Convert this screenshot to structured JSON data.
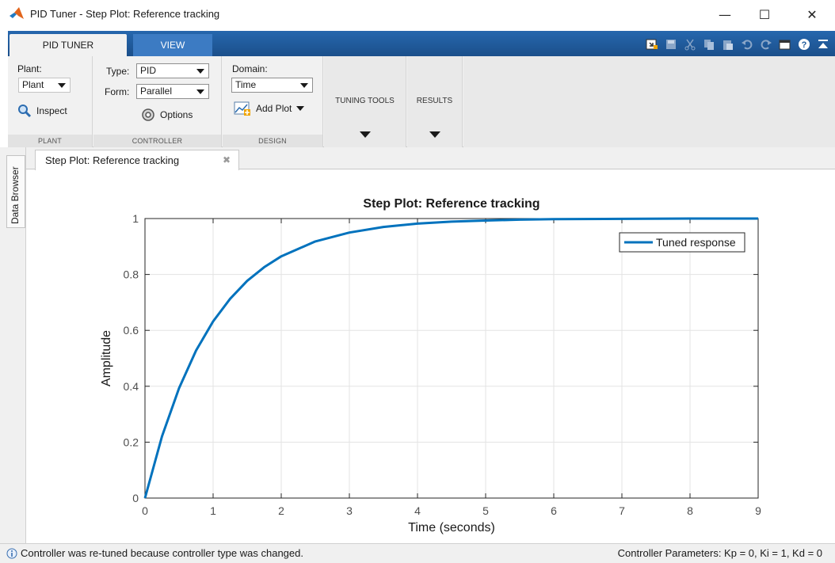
{
  "window": {
    "title": "PID Tuner - Step Plot: Reference tracking",
    "minimize_glyph": "—",
    "maximize_glyph": "☐",
    "close_glyph": "✕"
  },
  "tabs": {
    "pid_tuner": "PID TUNER",
    "view": "VIEW"
  },
  "quick_access": [
    "import-icon",
    "save-icon",
    "cut-icon",
    "copy-icon",
    "paste-icon",
    "undo-icon",
    "redo-icon",
    "window-icon",
    "help-icon",
    "collapse-icon"
  ],
  "ribbon": {
    "plant": {
      "label": "Plant:",
      "value": "Plant",
      "inspect": "Inspect",
      "group": "PLANT"
    },
    "controller": {
      "type_label": "Type:",
      "type_value": "PID",
      "form_label": "Form:",
      "form_value": "Parallel",
      "options": "Options",
      "group": "CONTROLLER"
    },
    "design": {
      "domain_label": "Domain:",
      "domain_value": "Time",
      "add_plot": "Add Plot",
      "group": "DESIGN"
    },
    "tuning_tools": "TUNING TOOLS",
    "results": "RESULTS"
  },
  "document": {
    "tab_label": "Step Plot: Reference tracking",
    "side_tab": "Data Browser"
  },
  "status": {
    "message": "Controller was re-tuned because controller type was changed.",
    "parameters": "Controller Parameters: Kp =  0, Ki =  1, Kd =  0"
  },
  "colors": {
    "ribbon_blue": "#1f5b9c",
    "series": "#0072bd"
  },
  "chart_data": {
    "type": "line",
    "title": "Step Plot: Reference tracking",
    "xlabel": "Time (seconds)",
    "ylabel": "Amplitude",
    "xlim": [
      0,
      9
    ],
    "ylim": [
      0,
      1
    ],
    "xticks": [
      "0",
      "1",
      "2",
      "3",
      "4",
      "5",
      "6",
      "7",
      "8",
      "9"
    ],
    "yticks": [
      "0",
      "0.2",
      "0.4",
      "0.6",
      "0.8",
      "1"
    ],
    "grid": true,
    "legend_position": "top-right",
    "series": [
      {
        "name": "Tuned response",
        "color": "#0072bd",
        "x": [
          0,
          0.25,
          0.5,
          0.75,
          1,
          1.25,
          1.5,
          1.75,
          2,
          2.5,
          3,
          3.5,
          4,
          4.5,
          5,
          5.5,
          6,
          7,
          8,
          9
        ],
        "y": [
          0,
          0.221,
          0.393,
          0.528,
          0.632,
          0.713,
          0.777,
          0.826,
          0.865,
          0.918,
          0.95,
          0.97,
          0.982,
          0.989,
          0.993,
          0.996,
          0.998,
          0.999,
          1.0,
          1.0
        ]
      }
    ]
  }
}
